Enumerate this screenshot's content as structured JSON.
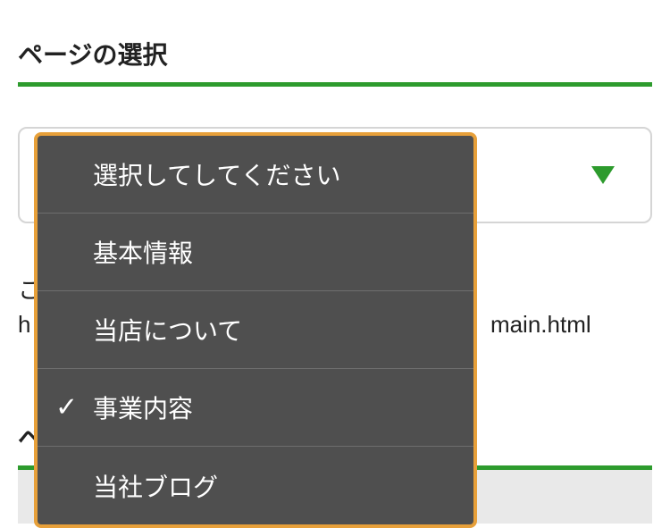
{
  "section": {
    "title": "ページの選択"
  },
  "url": {
    "label_fragment": "こ",
    "text_fragment": "h",
    "text_suffix": "main.html"
  },
  "section2": {
    "title_fragment": "ペ"
  },
  "dropdown": {
    "items": [
      {
        "label": "選択してしてください",
        "selected": false
      },
      {
        "label": "基本情報",
        "selected": false
      },
      {
        "label": "当店について",
        "selected": false
      },
      {
        "label": "事業内容",
        "selected": true
      },
      {
        "label": "当社ブログ",
        "selected": false
      }
    ]
  }
}
